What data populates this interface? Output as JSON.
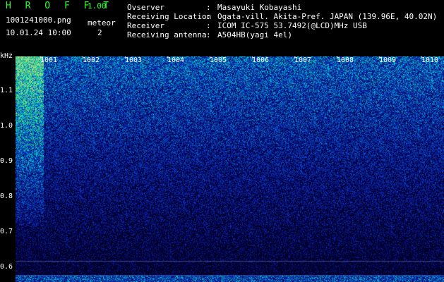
{
  "app": {
    "title": "H R O F F T",
    "version": "1.00"
  },
  "file": {
    "name": "1001241000.png",
    "datetime": "10.01.24 10:00"
  },
  "meteor": {
    "label": "meteor",
    "count": "2"
  },
  "info": [
    {
      "key": "Ovserver",
      "value": "Masayuki Kobayashi"
    },
    {
      "key": "Receiving Location",
      "value": "Ogata-vill. Akita-Pref. JAPAN (139.96E, 40.02N)"
    },
    {
      "key": "Receiver",
      "value": "ICOM IC-575 53.7492(@LCD)MHz USB"
    },
    {
      "key": "Receiving antenna",
      "value": "A504HB(yagi 4el)"
    }
  ],
  "spectrogram": {
    "y_unit": "kHz",
    "y_ticks": [
      "1.1",
      "1.0",
      "0.9",
      "0.8",
      "0.7",
      "0.6"
    ],
    "x_ticks": [
      "1001",
      "1002",
      "1003",
      "1004",
      "1005",
      "1006",
      "1007",
      "1008",
      "1009",
      "1010"
    ]
  },
  "colors": {
    "accent": "#33ff33",
    "background": "#000000",
    "noise": "#1a3a9a"
  }
}
